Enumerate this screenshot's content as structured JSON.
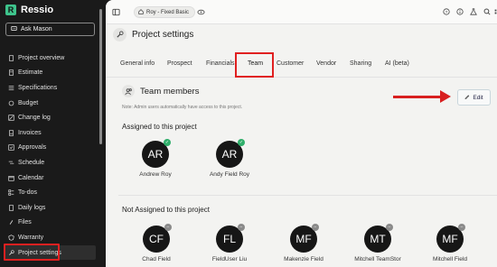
{
  "app": {
    "name": "Ressio",
    "logo_letter": "R"
  },
  "sidebar": {
    "ask_label": "Ask Mason",
    "items": [
      {
        "label": "Project overview",
        "icon": "document-icon"
      },
      {
        "label": "Estimate",
        "icon": "calculator-icon"
      },
      {
        "label": "Specifications",
        "icon": "list-icon"
      },
      {
        "label": "Budget",
        "icon": "budget-icon"
      },
      {
        "label": "Change log",
        "icon": "change-log-icon"
      },
      {
        "label": "Invoices",
        "icon": "invoice-icon"
      },
      {
        "label": "Approvals",
        "icon": "approvals-icon"
      },
      {
        "label": "Schedule",
        "icon": "schedule-icon"
      },
      {
        "label": "Calendar",
        "icon": "calendar-icon"
      },
      {
        "label": "To-dos",
        "icon": "todo-icon"
      },
      {
        "label": "Daily logs",
        "icon": "daily-logs-icon"
      },
      {
        "label": "Files",
        "icon": "files-icon"
      },
      {
        "label": "Warranty",
        "icon": "warranty-icon"
      },
      {
        "label": "Project settings",
        "icon": "wrench-icon",
        "active": true
      }
    ]
  },
  "topbar": {
    "project_chip": "Roy - Fixed Basic"
  },
  "page": {
    "title": "Project settings"
  },
  "tabs": [
    {
      "label": "General info"
    },
    {
      "label": "Prospect"
    },
    {
      "label": "Financials"
    },
    {
      "label": "Team",
      "active": true
    },
    {
      "label": "Customer"
    },
    {
      "label": "Vendor"
    },
    {
      "label": "Sharing"
    },
    {
      "label": "AI (beta)"
    }
  ],
  "team": {
    "title": "Team members",
    "note": "Note: Admin users automatically have access to this project.",
    "edit_label": "Edit",
    "assigned_title": "Assigned to this project",
    "assigned": [
      {
        "initials": "AR",
        "name": "Andrew Roy"
      },
      {
        "initials": "AR",
        "name": "Andy Field Roy"
      }
    ],
    "not_assigned_title": "Not Assigned to this project",
    "not_assigned": [
      {
        "initials": "CF",
        "name": "Chad Field"
      },
      {
        "initials": "FL",
        "name": "FieldUser Liu"
      },
      {
        "initials": "MF",
        "name": "Makenzie Field"
      },
      {
        "initials": "MT",
        "name": "Mitchell TeamStor"
      },
      {
        "initials": "MF",
        "name": "Mitchell Field"
      }
    ]
  },
  "colors": {
    "accent": "#2f8f64",
    "highlight": "#e02020",
    "sidebar_bg": "#1a1a1a"
  }
}
